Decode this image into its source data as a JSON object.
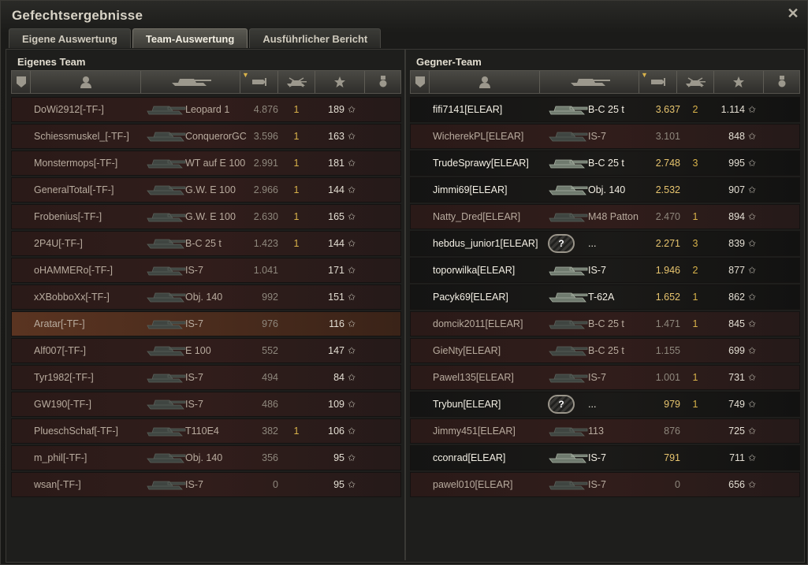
{
  "window": {
    "title": "Gefechtsergebnisse",
    "close_icon": "close-icon"
  },
  "tabs": [
    {
      "label": "Eigene Auswertung",
      "active": false
    },
    {
      "label": "Team-Auswertung",
      "active": true
    },
    {
      "label": "Ausführlicher Bericht",
      "active": false
    }
  ],
  "teams": {
    "own": {
      "title": "Eigenes Team",
      "players": [
        {
          "name": "DoWi2912[-TF-]",
          "tank": "Leopard 1",
          "damage": "4.876",
          "kills": "1",
          "xp": "189",
          "alive": false
        },
        {
          "name": "Schiessmuskel_[-TF-]",
          "tank": "ConquerorGC",
          "damage": "3.596",
          "kills": "1",
          "xp": "163",
          "alive": false
        },
        {
          "name": "Monstermops[-TF-]",
          "tank": "WT auf E 100",
          "damage": "2.991",
          "kills": "1",
          "xp": "181",
          "alive": false
        },
        {
          "name": "GeneralTotal[-TF-]",
          "tank": "G.W. E 100",
          "damage": "2.966",
          "kills": "1",
          "xp": "144",
          "alive": false
        },
        {
          "name": "Frobenius[-TF-]",
          "tank": "G.W. E 100",
          "damage": "2.630",
          "kills": "1",
          "xp": "165",
          "alive": false
        },
        {
          "name": "2P4U[-TF-]",
          "tank": "B-C 25 t",
          "damage": "1.423",
          "kills": "1",
          "xp": "144",
          "alive": false
        },
        {
          "name": "oHAMMERo[-TF-]",
          "tank": "IS-7",
          "damage": "1.041",
          "kills": "",
          "xp": "171",
          "alive": false
        },
        {
          "name": "xXBobboXx[-TF-]",
          "tank": "Obj. 140",
          "damage": "992",
          "kills": "",
          "xp": "151",
          "alive": false
        },
        {
          "name": "Aratar[-TF-]",
          "tank": "IS-7",
          "damage": "976",
          "kills": "",
          "xp": "116",
          "alive": false,
          "self": true
        },
        {
          "name": "Alf007[-TF-]",
          "tank": "E 100",
          "damage": "552",
          "kills": "",
          "xp": "147",
          "alive": false
        },
        {
          "name": "Tyr1982[-TF-]",
          "tank": "IS-7",
          "damage": "494",
          "kills": "",
          "xp": "84",
          "alive": false
        },
        {
          "name": "GW190[-TF-]",
          "tank": "IS-7",
          "damage": "486",
          "kills": "",
          "xp": "109",
          "alive": false
        },
        {
          "name": "PlueschSchaf[-TF-]",
          "tank": "T110E4",
          "damage": "382",
          "kills": "1",
          "xp": "106",
          "alive": false
        },
        {
          "name": "m_phil[-TF-]",
          "tank": "Obj. 140",
          "damage": "356",
          "kills": "",
          "xp": "95",
          "alive": false
        },
        {
          "name": "wsan[-TF-]",
          "tank": "IS-7",
          "damage": "0",
          "kills": "",
          "xp": "95",
          "alive": false
        }
      ]
    },
    "enemy": {
      "title": "Gegner-Team",
      "players": [
        {
          "name": "fifi7141[ELEAR]",
          "tank": "B-C 25 t",
          "damage": "3.637",
          "kills": "2",
          "xp": "1.114",
          "alive": true
        },
        {
          "name": "WicherekPL[ELEAR]",
          "tank": "IS-7",
          "damage": "3.101",
          "kills": "",
          "xp": "848",
          "alive": false
        },
        {
          "name": "TrudeSprawy[ELEAR]",
          "tank": "B-C 25 t",
          "damage": "2.748",
          "kills": "3",
          "xp": "995",
          "alive": true
        },
        {
          "name": "Jimmi69[ELEAR]",
          "tank": "Obj. 140",
          "damage": "2.532",
          "kills": "",
          "xp": "907",
          "alive": true
        },
        {
          "name": "Natty_Dred[ELEAR]",
          "tank": "M48 Patton",
          "damage": "2.470",
          "kills": "1",
          "xp": "894",
          "alive": false
        },
        {
          "name": "hebdus_junior1[ELEAR]",
          "tank": "...",
          "damage": "2.271",
          "kills": "3",
          "xp": "839",
          "alive": true,
          "unknown": true
        },
        {
          "name": "toporwilka[ELEAR]",
          "tank": "IS-7",
          "damage": "1.946",
          "kills": "2",
          "xp": "877",
          "alive": true
        },
        {
          "name": "Pacyk69[ELEAR]",
          "tank": "T-62A",
          "damage": "1.652",
          "kills": "1",
          "xp": "862",
          "alive": true
        },
        {
          "name": "domcik2011[ELEAR]",
          "tank": "B-C 25 t",
          "damage": "1.471",
          "kills": "1",
          "xp": "845",
          "alive": false
        },
        {
          "name": "GieNty[ELEAR]",
          "tank": "B-C 25 t",
          "damage": "1.155",
          "kills": "",
          "xp": "699",
          "alive": false
        },
        {
          "name": "Pawel135[ELEAR]",
          "tank": "IS-7",
          "damage": "1.001",
          "kills": "1",
          "xp": "731",
          "alive": false
        },
        {
          "name": "Trybun[ELEAR]",
          "tank": "...",
          "damage": "979",
          "kills": "1",
          "xp": "749",
          "alive": true,
          "unknown": true
        },
        {
          "name": "Jimmy451[ELEAR]",
          "tank": "113",
          "damage": "876",
          "kills": "",
          "xp": "725",
          "alive": false
        },
        {
          "name": "cconrad[ELEAR]",
          "tank": "IS-7",
          "damage": "791",
          "kills": "",
          "xp": "711",
          "alive": true
        },
        {
          "name": "pawel010[ELEAR]",
          "tank": "IS-7",
          "damage": "0",
          "kills": "",
          "xp": "656",
          "alive": false
        }
      ]
    }
  },
  "columns": {
    "icons": [
      "squad-icon",
      "player-icon",
      "tank-icon",
      "damage-icon",
      "kills-icon",
      "xp-star-icon",
      "medal-icon"
    ],
    "sorted_column": "damage-icon"
  },
  "unknown_tank_glyph": "?",
  "star_glyph": "✩",
  "colors": {
    "self_row": "#5a3421",
    "dead_row": "#2e1c1a",
    "alive_row": "#171615",
    "damage_highlight": "#e7c46e",
    "kills": "#d8b24a"
  }
}
